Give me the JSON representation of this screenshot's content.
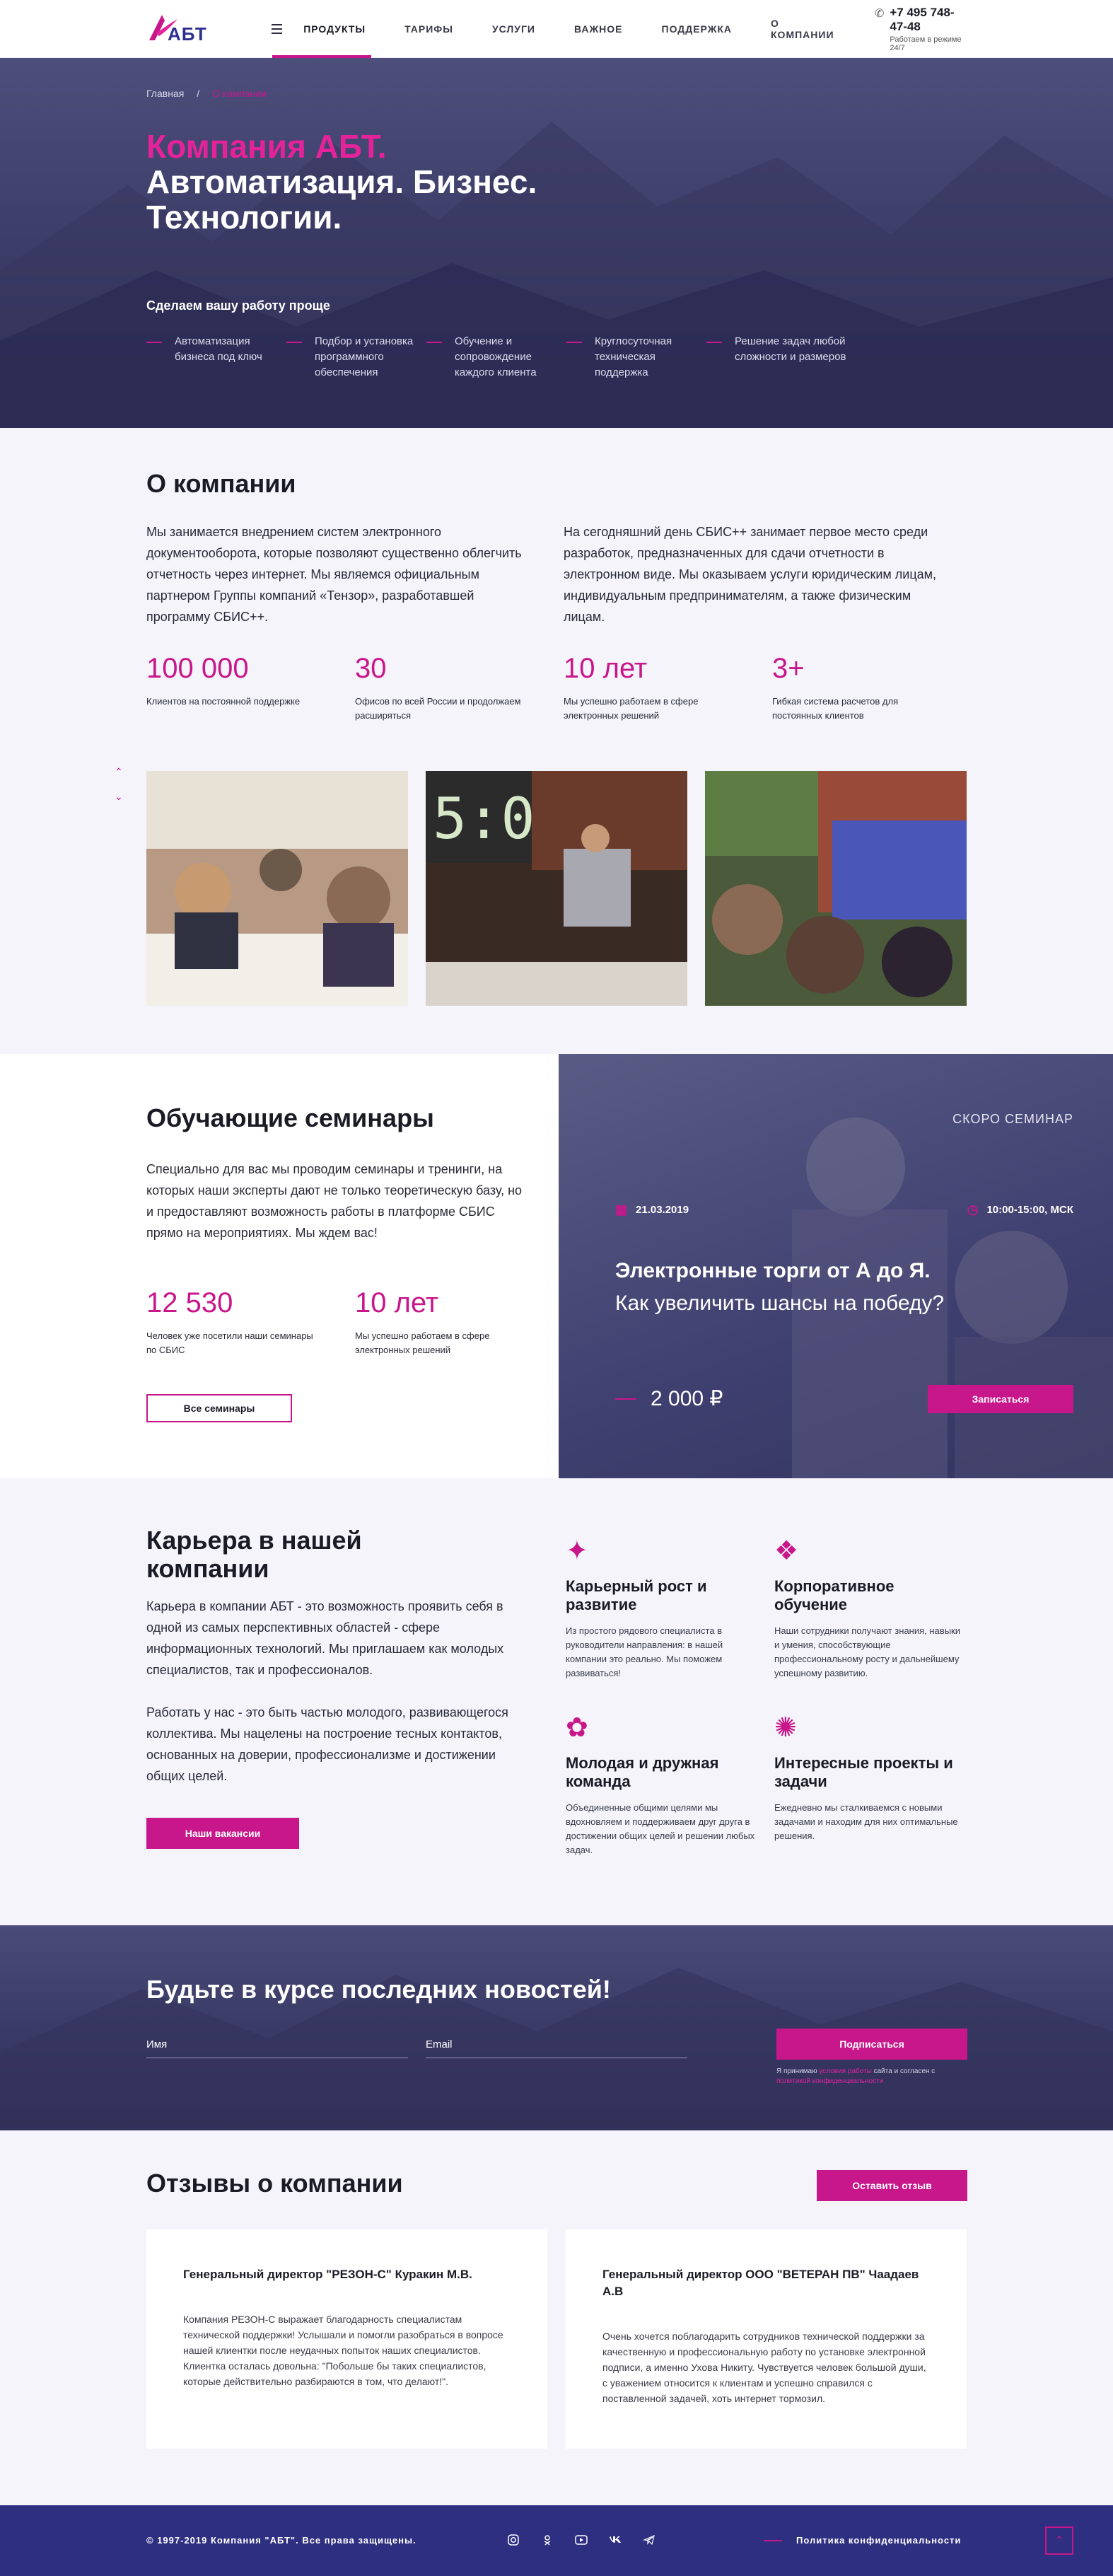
{
  "header": {
    "logo_text": "АБТ",
    "nav": [
      "ПРОДУКТЫ",
      "ТАРИФЫ",
      "УСЛУГИ",
      "ВАЖНОЕ",
      "ПОДДЕРЖКА",
      "О КОМПАНИИ"
    ],
    "phone": "+7 495 748-47-48",
    "phone_note": "Работаем в режиме 24/7"
  },
  "hero": {
    "breadcrumb_home": "Главная",
    "breadcrumb_sep": "/",
    "breadcrumb_current": "О компании",
    "title_accent": "Компания АБТ.",
    "title_main": "Автоматизация. Бизнес. Технологии.",
    "subtitle": "Сделаем вашу работу проще",
    "features": [
      "Автоматизация бизнеса под ключ",
      "Подбор и установка программного обеспечения",
      "Обучение и сопровождение каждого клиента",
      "Круглосуточная техническая поддержка",
      "Решение задач любой сложности и размеров"
    ]
  },
  "about": {
    "title": "О компании",
    "col1": "Мы занимается внедрением систем электронного документооборота, которые позволяют существенно облегчить отчетность через интернет. Мы являемся официальным партнером Группы компаний «Тензор», разработавшей программу СБИС++.",
    "col2": "На сегодняшний день СБИС++ занимает первое место среди разработок, предназначенных для сдачи отчетности в электронном виде. Мы оказываем услуги юридическим лицам, индивидуальным предпринимателям, а также физическим лицам.",
    "stats": [
      {
        "num": "100 000",
        "text": "Клиентов на постоянной поддержке"
      },
      {
        "num": "30",
        "text": "Офисов по всей России и продолжаем расширяться"
      },
      {
        "num": "10 лет",
        "text": "Мы успешно работаем в сфере электронных решений"
      },
      {
        "num": "3+",
        "text": "Гибкая система расчетов для постоянных клиентов"
      }
    ],
    "arrow_up": "⌃",
    "arrow_down": "⌄"
  },
  "seminars": {
    "title": "Обучающие семинары",
    "text": "Специально для вас мы проводим семинары и тренинги, на которых наши эксперты дают не только теоретическую базу, но и предоставляют возможность работы в платформе СБИС прямо на мероприятиях. Мы ждем вас!",
    "stats": [
      {
        "num": "12 530",
        "text": "Человек уже посетили наши семинары по СБИС"
      },
      {
        "num": "10 лет",
        "text": "Мы успешно работаем в сфере электронных решений"
      }
    ],
    "all_button": "Все семинары",
    "card": {
      "soon": "СКОРО СЕМИНАР",
      "date": "21.03.2019",
      "time": "10:00-15:00, МСК",
      "title_bold": "Электронные торги от А до Я.",
      "title_rest": "Как увеличить шансы на победу?",
      "price": "2 000 ₽",
      "signup": "Записаться"
    }
  },
  "career": {
    "title": "Карьера в нашей компании",
    "p1": "Карьера в компании АБТ - это возможность проявить себя в одной из самых перспективных областей - сфере информационных технологий. Мы приглашаем как молодых специалистов, так и профессионалов.",
    "p2": "Работать у нас - это быть частью молодого, развивающегося коллектива. Мы нацелены на построение тесных контактов, основанных на доверии, профессионализме и достижении общих целей.",
    "button": "Наши вакансии",
    "perks": [
      {
        "icon": "rocket-icon",
        "glyph": "✦",
        "title": "Карьерный рост и развитие",
        "text": "Из простого рядового специалиста в руководители направления: в нашей компании это реально. Мы поможем развиваться!"
      },
      {
        "icon": "book-icon",
        "glyph": "❖",
        "title": "Корпоративное обучение",
        "text": "Наши сотрудники получают знания, навыки и умения, способствующие профессиональному росту и дальнейшему успешному развитию."
      },
      {
        "icon": "team-icon",
        "glyph": "✿",
        "title": "Молодая и дружная команда",
        "text": "Объединенные общими целями мы вдохновляем и поддерживаем друг друга в достижении общих целей и решении любых задач."
      },
      {
        "icon": "brain-icon",
        "glyph": "✺",
        "title": "Интересные проекты и задачи",
        "text": "Ежедневно мы сталкиваемся с новыми задачами и находим для них оптимальные решения."
      }
    ]
  },
  "newsletter": {
    "title": "Будьте в курсе последних новостей!",
    "name_label": "Имя",
    "email_label": "Email",
    "button": "Подписаться",
    "agree_pre": "Я принимаю",
    "agree_link": "условия работы",
    "agree_mid": "сайта и согласен с",
    "agree_link2": "политикой конфиденциальности"
  },
  "reviews": {
    "title": "Отзывы о компании",
    "button": "Оставить отзыв",
    "items": [
      {
        "title": "Генеральный директор \"РЕЗОН-С\" Куракин М.В.",
        "text": "Компания РЕЗОН-С выражает благодарность специалистам технической поддержки! Услышали и помогли разобраться в вопросе нашей клиентки после неудачных попыток наших специалистов. Клиентка осталась довольна: \"Побольше бы таких специалистов, которые действительно разбираются в том, что делают!\"."
      },
      {
        "title": "Генеральный директор ООО \"ВЕТЕРАН ПВ\" Чаадаев А.В",
        "text": "Очень хочется поблагодарить сотрудников технической поддержки за качественную и профессиональную работу по установке электронной подписи, а именно Ухова Никиту. Чувствуется человек большой души, с уважением относится к клиентам и успешно справился с поставленной задачей, хоть интернет тормозил."
      }
    ]
  },
  "footer": {
    "copyright": "© 1997-2019 Компания \"АБТ\". Все права защищены.",
    "socials": [
      "instagram-icon",
      "odnoklassniki-icon",
      "youtube-icon",
      "vk-icon",
      "telegram-icon"
    ],
    "policy": "Политика конфиденциальности",
    "to_top": "⌃"
  },
  "colors": {
    "accent": "#c8168b",
    "dark_blue": "#2e2f80",
    "hero_bg": "#3c3d68"
  }
}
